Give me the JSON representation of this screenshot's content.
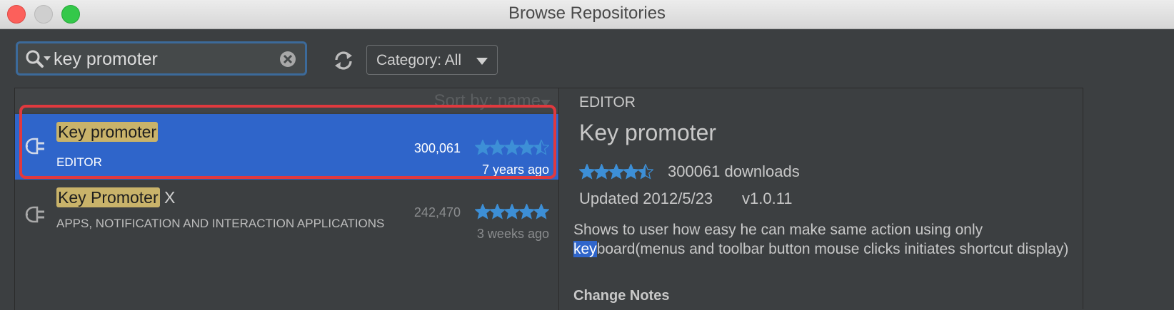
{
  "window": {
    "title": "Browse Repositories"
  },
  "toolbar": {
    "search_value": "key promoter",
    "category_label": "Category: All"
  },
  "list": {
    "sort_label": "Sort by: name",
    "items": [
      {
        "name_highlight": "Key promoter",
        "name_rest": "",
        "category": "EDITOR",
        "downloads": "300,061",
        "updated": "7 years ago",
        "rating": 4.5,
        "selected": true
      },
      {
        "name_highlight": "Key Promoter",
        "name_rest": " X",
        "category": "APPS, NOTIFICATION AND INTERACTION APPLICATIONS",
        "downloads": "242,470",
        "updated": "3 weeks ago",
        "rating": 5,
        "selected": false
      }
    ]
  },
  "detail": {
    "category": "EDITOR",
    "name": "Key promoter",
    "rating": 4.5,
    "downloads": "300061 downloads",
    "updated": "Updated 2012/5/23",
    "version": "v1.0.11",
    "description_line1": "Shows to user how easy he can make same action using only",
    "description_sel": "key",
    "description_rest": "board(menus and toolbar button mouse clicks initiates shortcut display)",
    "notes_heading": "Change Notes"
  },
  "colors": {
    "selection": "#2f65ca",
    "star": "#3d8fd6",
    "highlight": "#c9b36a",
    "outline": "#e0393e"
  }
}
